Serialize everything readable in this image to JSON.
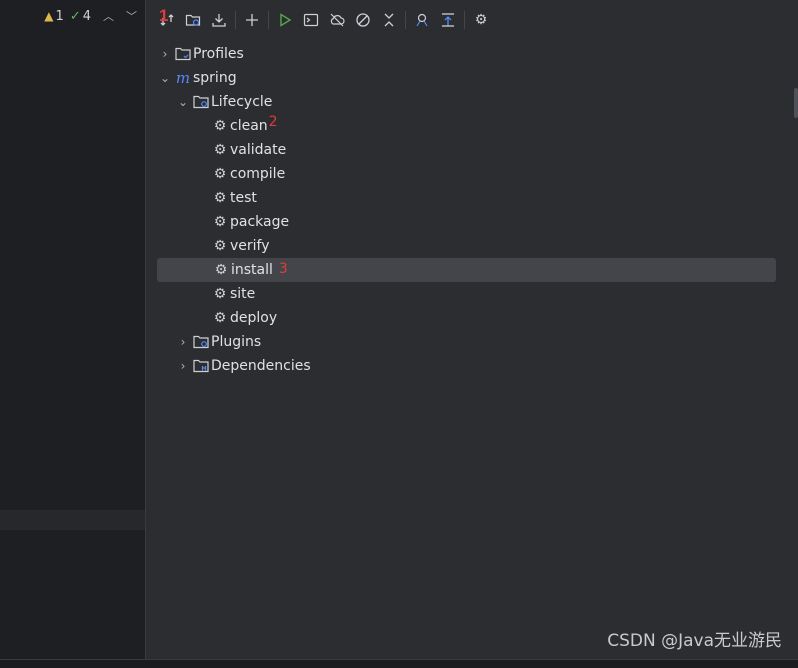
{
  "editor": {
    "warnings": "1",
    "checks": "4"
  },
  "toolbar": {
    "buttons": [
      {
        "name": "reload-all-maven-projects-button",
        "icon": "reload-icon"
      },
      {
        "name": "generate-sources-button",
        "icon": "folder-sync-icon"
      },
      {
        "name": "download-sources-button",
        "icon": "download-icon"
      },
      {
        "name": "add-maven-project-button",
        "icon": "plus-icon"
      },
      {
        "name": "run-maven-build-button",
        "icon": "play-icon"
      },
      {
        "name": "execute-maven-goal-button",
        "icon": "terminal-icon"
      },
      {
        "name": "toggle-offline-mode-button",
        "icon": "cloud-off-icon"
      },
      {
        "name": "skip-tests-button",
        "icon": "skip-icon"
      },
      {
        "name": "collapse-all-button",
        "icon": "collapse-icon"
      },
      {
        "name": "show-dependencies-button",
        "icon": "dependencies-icon"
      },
      {
        "name": "expand-all-button",
        "icon": "expand-icon"
      },
      {
        "name": "maven-settings-button",
        "icon": "gear-icon"
      }
    ],
    "marker": "1"
  },
  "tree": {
    "profiles": "Profiles",
    "project": "spring",
    "lifecycle": "Lifecycle",
    "goals": [
      "clean",
      "validate",
      "compile",
      "test",
      "package",
      "verify",
      "install",
      "site",
      "deploy"
    ],
    "plugins": "Plugins",
    "dependencies": "Dependencies"
  },
  "markers": {
    "clean": "2",
    "install": "3"
  },
  "watermark": "CSDN @Java无业游民",
  "colors": {
    "accent_marker": "#e03b3b",
    "selection": "#43454a",
    "run_green": "#57a64a",
    "maven_blue": "#548af7"
  }
}
